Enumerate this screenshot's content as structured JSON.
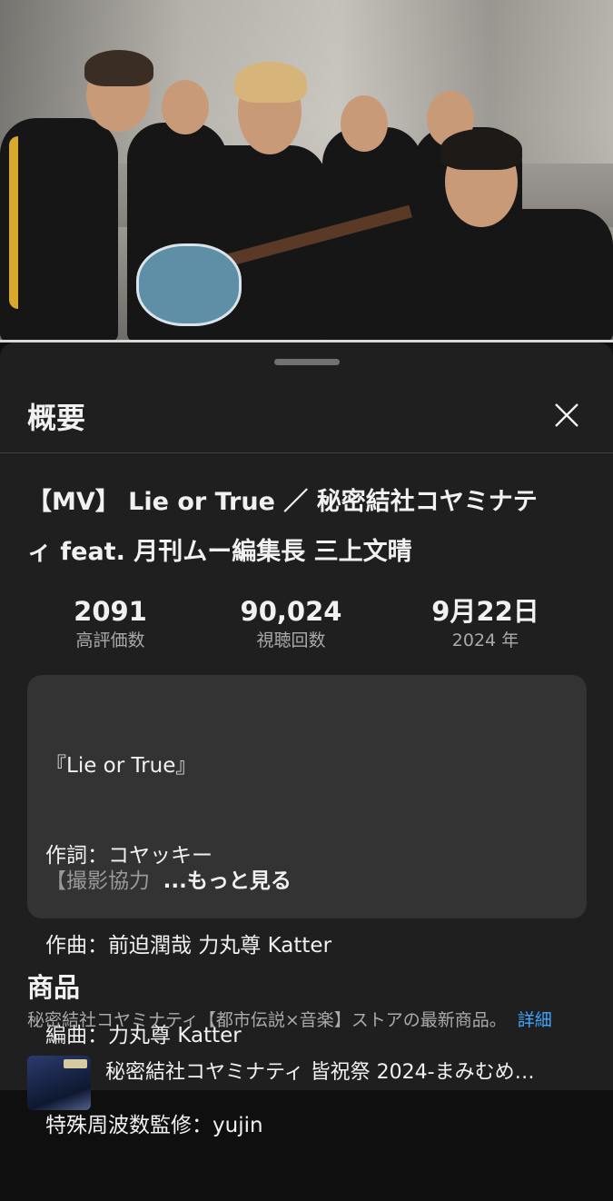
{
  "sheet": {
    "title": "概要",
    "close_icon": "close-icon"
  },
  "video": {
    "title_line1": "【MV】 Lie or True ／ 秘密結社コヤミナテ",
    "title_line2": "ィ feat. 月刊ムー編集長 三上文晴"
  },
  "stats": [
    {
      "value": "2091",
      "label": "高評価数"
    },
    {
      "value": "90,024",
      "label": "視聴回数"
    },
    {
      "value": "9月22日",
      "label": "2024 年"
    }
  ],
  "description": {
    "lines": [
      "『Lie or True』",
      "作詞：コヤッキー",
      "作曲：前迫潤哉 力丸尊 Katter",
      "編曲：力丸尊 Katter",
      "特殊周波数監修：yujin"
    ],
    "truncated_text": "【撮影協力",
    "more_label": "...もっと見る"
  },
  "products": {
    "heading": "商品",
    "subtitle": "秘密結社コヤミナティ【都市伝説×音楽】ストアの最新商品。",
    "details_link": "詳細",
    "items": [
      {
        "title": "秘密結社コヤミナティ 皆祝祭 2024-まみむめ…"
      }
    ]
  },
  "colors": {
    "background": "#0f0f0f",
    "sheet": "#1f1f1f",
    "description_box": "#333333",
    "link": "#3ea6ff",
    "secondary_text": "#aaaaaa"
  }
}
